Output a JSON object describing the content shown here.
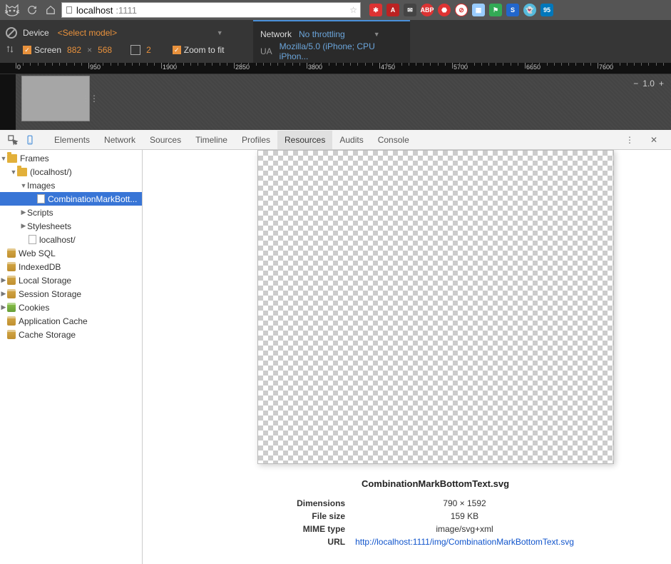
{
  "browser": {
    "url_host": "localhost",
    "url_rest": ":1111"
  },
  "device_toolbar": {
    "device_label": "Device",
    "select_model": "<Select model>",
    "screen_label": "Screen",
    "width": "882",
    "times": "×",
    "height": "568",
    "dpr": "2",
    "zoom_fit": "Zoom to fit",
    "network_label": "Network",
    "throttling": "No throttling",
    "ua_label": "UA",
    "ua_value": "Mozilla/5.0 (iPhone; CPU iPhon..."
  },
  "ruler_ticks": [
    "0",
    "950",
    "1900",
    "2850",
    "3800",
    "4750",
    "5700",
    "6650",
    "7600"
  ],
  "zoom": {
    "minus": "−",
    "value": "1.0",
    "plus": "+"
  },
  "devtools_tabs": [
    "Elements",
    "Network",
    "Sources",
    "Timeline",
    "Profiles",
    "Resources",
    "Audits",
    "Console"
  ],
  "devtools_active_tab": "Resources",
  "sidebar_tree": {
    "frames": "Frames",
    "localhost": "(localhost/)",
    "images": "Images",
    "selected_file": "CombinationMarkBott...",
    "scripts": "Scripts",
    "stylesheets": "Stylesheets",
    "localhost_file": "localhost/",
    "websql": "Web SQL",
    "indexeddb": "IndexedDB",
    "localstorage": "Local Storage",
    "sessionstorage": "Session Storage",
    "cookies": "Cookies",
    "appcache": "Application Cache",
    "cachestorage": "Cache Storage"
  },
  "resource": {
    "filename": "CombinationMarkBottomText.svg",
    "dimensions_label": "Dimensions",
    "dimensions_value": "790 × 1592",
    "filesize_label": "File size",
    "filesize_value": "159 KB",
    "mime_label": "MIME type",
    "mime_value": "image/svg+xml",
    "url_label": "URL",
    "url_value": "http://localhost:1111/img/CombinationMarkBottomText.svg"
  }
}
